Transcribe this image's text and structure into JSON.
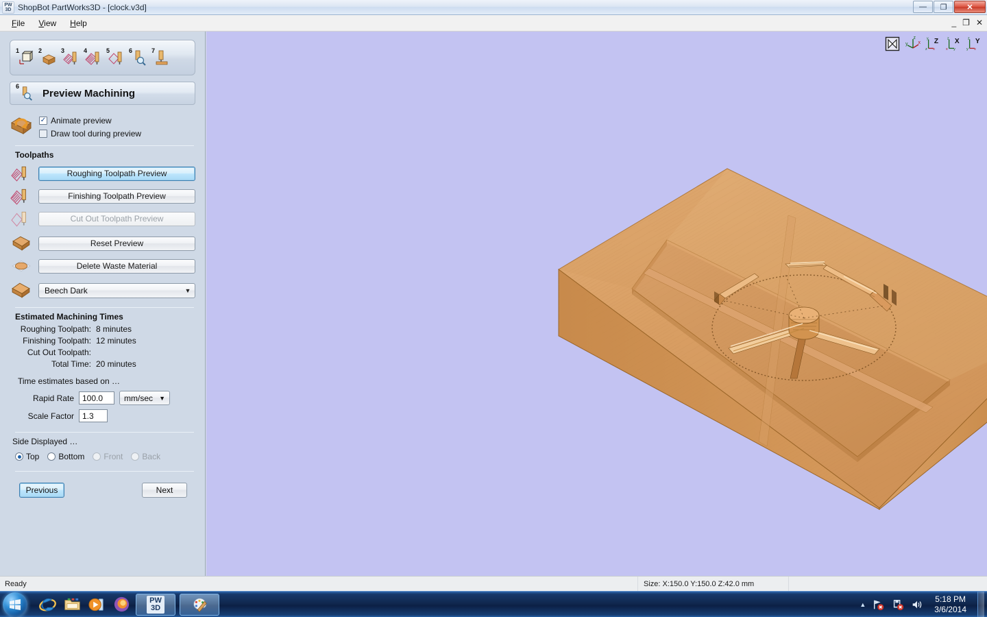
{
  "window": {
    "app_icon": [
      "PW",
      "3D"
    ],
    "title": "ShopBot PartWorks3D - [clock.v3d]",
    "minimize": "—",
    "restore": "❐",
    "close": "✕",
    "doc_minimize": "_",
    "doc_restore": "❐",
    "doc_close": "✕"
  },
  "menu": {
    "items": [
      {
        "label": "File",
        "accel": "F"
      },
      {
        "label": "View",
        "accel": "V"
      },
      {
        "label": "Help",
        "accel": "H"
      }
    ]
  },
  "steps": {
    "icons": [
      {
        "num": "1",
        "name": "model-setup-icon"
      },
      {
        "num": "2",
        "name": "import-component-icon"
      },
      {
        "num": "3",
        "name": "roughing-toolpath-icon"
      },
      {
        "num": "4",
        "name": "finishing-toolpath-icon"
      },
      {
        "num": "5",
        "name": "cutout-toolpath-icon"
      },
      {
        "num": "6",
        "name": "preview-machining-icon"
      },
      {
        "num": "7",
        "name": "save-toolpath-icon"
      }
    ],
    "current_num": "6",
    "current_title": "Preview Machining"
  },
  "options": {
    "animate_preview": {
      "label": "Animate preview",
      "checked": true,
      "mark": "✓"
    },
    "draw_tool": {
      "label": "Draw tool during preview",
      "checked": false,
      "mark": ""
    }
  },
  "toolpaths": {
    "section_title": "Toolpaths",
    "buttons": [
      {
        "label": "Roughing Toolpath Preview",
        "state": "highlight",
        "icon": "roughing-toolpath-icon"
      },
      {
        "label": "Finishing Toolpath Preview",
        "state": "normal",
        "icon": "finishing-toolpath-icon"
      },
      {
        "label": "Cut Out Toolpath Preview",
        "state": "disabled",
        "icon": "cutout-toolpath-icon"
      },
      {
        "label": "Reset Preview",
        "state": "normal",
        "icon": "material-block-icon"
      },
      {
        "label": "Delete Waste Material",
        "state": "normal",
        "icon": "waste-material-icon"
      }
    ],
    "material_select": {
      "value": "Beech Dark",
      "arrow": "▼",
      "icon": "material-swatch-icon"
    }
  },
  "estimates": {
    "title": "Estimated Machining Times",
    "rows": [
      {
        "label": "Roughing Toolpath:",
        "value": "8 minutes"
      },
      {
        "label": "Finishing Toolpath:",
        "value": "12 minutes"
      },
      {
        "label": "Cut Out Toolpath:",
        "value": ""
      },
      {
        "label": "Total Time:",
        "value": "20 minutes"
      }
    ],
    "note": "Time estimates based on …",
    "rapid_rate": {
      "label": "Rapid Rate",
      "value": "100.0",
      "unit": "mm/sec",
      "arrow": "▼"
    },
    "scale_factor": {
      "label": "Scale Factor",
      "value": "1.3"
    }
  },
  "side_displayed": {
    "title": "Side Displayed …",
    "options": [
      {
        "label": "Top",
        "selected": true,
        "disabled": false
      },
      {
        "label": "Bottom",
        "selected": false,
        "disabled": false
      },
      {
        "label": "Front",
        "selected": false,
        "disabled": true
      },
      {
        "label": "Back",
        "selected": false,
        "disabled": true
      }
    ]
  },
  "nav": {
    "previous": "Previous",
    "next": "Next"
  },
  "viewport": {
    "background": "#c3c3f2",
    "axis_tools": [
      {
        "name": "zoom-extents-icon",
        "label": ""
      },
      {
        "name": "isometric-view-icon",
        "label": ""
      },
      {
        "name": "view-z-icon",
        "label": "Z"
      },
      {
        "name": "view-x-icon",
        "label": "X"
      },
      {
        "name": "view-y-icon",
        "label": "Y"
      }
    ],
    "axis_letters": {
      "x": "x",
      "y": "y",
      "z": "z"
    },
    "model": {
      "name": "clock-face-machined-block",
      "material_top": "#d9a267",
      "material_side": "#c98c4e",
      "material_front": "#d89a5c"
    }
  },
  "statusbar": {
    "ready": "Ready",
    "size": "Size: X:150.0 Y:150.0 Z:42.0 mm"
  },
  "taskbar": {
    "start": "start-orb",
    "quicklaunch": [
      {
        "name": "internet-explorer-icon"
      },
      {
        "name": "windows-explorer-icon"
      },
      {
        "name": "media-player-icon"
      },
      {
        "name": "firefox-icon"
      }
    ],
    "tasks": [
      {
        "name": "partworks3d-task",
        "label": [
          "PW",
          "3D"
        ],
        "active": true
      },
      {
        "name": "paint-task",
        "label": "",
        "active": false
      }
    ],
    "tray": {
      "arrow": "▲",
      "icons": [
        {
          "name": "network-error-icon"
        },
        {
          "name": "action-center-icon"
        },
        {
          "name": "volume-icon"
        }
      ],
      "time": "5:18 PM",
      "date": "3/6/2014"
    }
  }
}
